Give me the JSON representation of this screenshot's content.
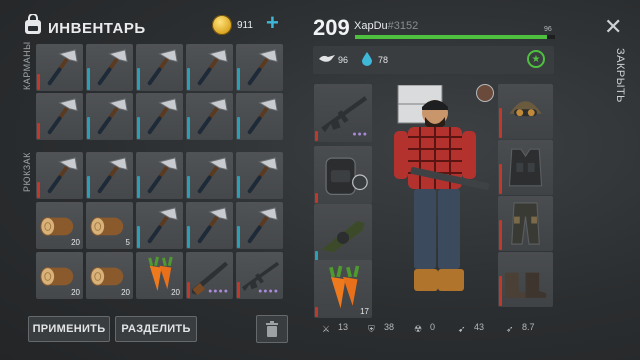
{
  "header": {
    "title": "ИНВЕНТАРЬ",
    "coins": "911",
    "plus_symbol": "+"
  },
  "sections": {
    "pockets_label": "КАРМАНЫ",
    "backpack_label": "РЮКЗАК"
  },
  "inventory": {
    "pockets": [
      {
        "item": "axe-icon",
        "durability": "red"
      },
      {
        "item": "axe-icon",
        "durability": "teal"
      },
      {
        "item": "axe-icon",
        "durability": "teal"
      },
      {
        "item": "axe-icon",
        "durability": "teal"
      },
      {
        "item": "axe-icon",
        "durability": "teal"
      },
      {
        "item": "axe-icon",
        "durability": "red"
      },
      {
        "item": "axe-icon",
        "durability": "teal"
      },
      {
        "item": "axe-icon",
        "durability": "teal"
      },
      {
        "item": "axe-icon",
        "durability": "teal"
      },
      {
        "item": "axe-icon",
        "durability": "teal"
      }
    ],
    "backpack": [
      {
        "item": "axe-icon",
        "durability": "red",
        "qty": ""
      },
      {
        "item": "axe-icon",
        "durability": "teal",
        "qty": ""
      },
      {
        "item": "axe-icon",
        "durability": "teal",
        "qty": ""
      },
      {
        "item": "axe-icon",
        "durability": "teal",
        "qty": ""
      },
      {
        "item": "axe-icon",
        "durability": "teal",
        "qty": ""
      },
      {
        "item": "log-icon",
        "durability": "",
        "qty": "20"
      },
      {
        "item": "log-icon",
        "durability": "",
        "qty": "5"
      },
      {
        "item": "axe-icon",
        "durability": "teal",
        "qty": ""
      },
      {
        "item": "axe-icon",
        "durability": "teal",
        "qty": ""
      },
      {
        "item": "axe-icon",
        "durability": "teal",
        "qty": ""
      },
      {
        "item": "log-icon",
        "durability": "",
        "qty": "20"
      },
      {
        "item": "log-icon",
        "durability": "",
        "qty": "20"
      },
      {
        "item": "carrot-icon",
        "durability": "",
        "qty": "20"
      },
      {
        "item": "shotgun-icon",
        "durability": "red",
        "qty": "●●●●"
      },
      {
        "item": "rifle-icon",
        "durability": "red",
        "qty": "●●●●"
      }
    ]
  },
  "buttons": {
    "apply": "ПРИМЕНИТЬ",
    "split": "РАЗДЕЛИТЬ"
  },
  "player": {
    "level": "209",
    "name": "XapDu",
    "id": "#3152",
    "xp_progress_percent": 96,
    "xp_label": "96",
    "stat_weight": "96",
    "stat_water": "78"
  },
  "weapons": [
    {
      "item": "rifle-icon",
      "extra": "●●●"
    },
    {
      "item": "backpack-icon",
      "extra": ""
    },
    {
      "item": "grenade-launcher-icon",
      "extra": ""
    },
    {
      "item": "carrot-icon",
      "extra": "17"
    }
  ],
  "gear": [
    "helmet-icon",
    "vest-icon",
    "pants-icon",
    "boots-icon"
  ],
  "bottom_stats": {
    "attack": "13",
    "defense": "38",
    "radiation": "0",
    "speed": "43",
    "stealth": "8.7"
  },
  "close": {
    "label": "ЗАКРЫТЬ",
    "symbol": "✕"
  },
  "colors": {
    "durability_red": "#c0392b",
    "durability_teal": "#2a9fb6",
    "xp_green": "#4fbf3f",
    "accent_blue": "#3fb8d8"
  }
}
